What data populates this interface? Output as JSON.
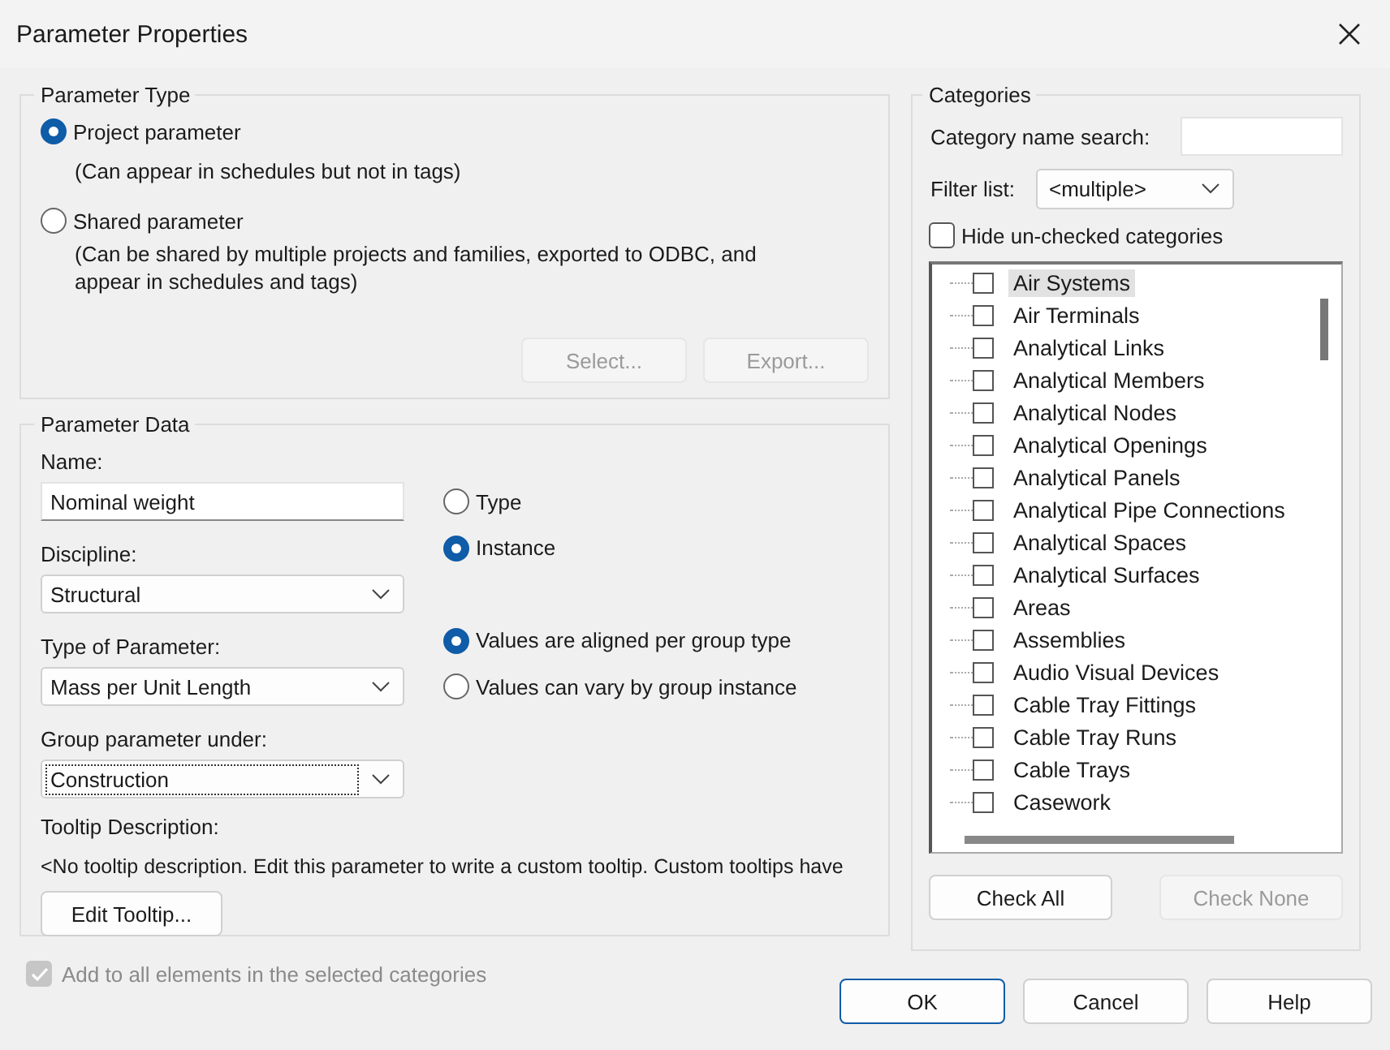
{
  "window": {
    "title": "Parameter Properties"
  },
  "parameter_type": {
    "title": "Parameter Type",
    "options": [
      {
        "label": "Project parameter",
        "description": "(Can appear in schedules but not in tags)",
        "selected": true
      },
      {
        "label": "Shared parameter",
        "description": "(Can be shared by multiple projects and families, exported to ODBC, and appear in schedules and tags)",
        "selected": false
      }
    ],
    "buttons": [
      {
        "label": "Select...",
        "disabled": true
      },
      {
        "label": "Export...",
        "disabled": true
      }
    ]
  },
  "parameter_data": {
    "title": "Parameter Data",
    "fields": [
      {
        "kind": "text",
        "label": "Name:",
        "value": "Nominal weight"
      },
      {
        "kind": "dropdown",
        "label": "Discipline:",
        "value": "Structural",
        "focused": false
      },
      {
        "kind": "dropdown",
        "label": "Type of Parameter:",
        "value": "Mass per Unit Length",
        "focused": false
      },
      {
        "kind": "dropdown",
        "label": "Group parameter under:",
        "value": "Construction",
        "focused": true
      }
    ],
    "type_options": [
      {
        "label": "Type",
        "selected": false
      },
      {
        "label": "Instance",
        "selected": true
      }
    ],
    "group_options": [
      {
        "label": "Values are aligned per group type",
        "selected": true
      },
      {
        "label": "Values can vary by group instance",
        "selected": false
      }
    ],
    "tooltip": {
      "label": "Tooltip Description:",
      "text": "<No tooltip description. Edit this parameter to write a custom tooltip. Custom tooltips have"
    },
    "edit_button": {
      "label": "Edit Tooltip...",
      "disabled": false
    }
  },
  "add_to_all": {
    "label": "Add to all elements in the selected categories",
    "checked": true,
    "disabled": true
  },
  "categories": {
    "title": "Categories",
    "search": {
      "label": "Category name search:"
    },
    "filter": {
      "label": "Filter list:",
      "value": "<multiple>"
    },
    "hide_unchecked": {
      "label": "Hide un-checked categories",
      "checked": false
    },
    "items": [
      {
        "label": "Air Systems",
        "checked": false,
        "selected": true
      },
      {
        "label": "Air Terminals",
        "checked": false,
        "selected": false
      },
      {
        "label": "Analytical Links",
        "checked": false,
        "selected": false
      },
      {
        "label": "Analytical Members",
        "checked": false,
        "selected": false
      },
      {
        "label": "Analytical Nodes",
        "checked": false,
        "selected": false
      },
      {
        "label": "Analytical Openings",
        "checked": false,
        "selected": false
      },
      {
        "label": "Analytical Panels",
        "checked": false,
        "selected": false
      },
      {
        "label": "Analytical Pipe Connections",
        "checked": false,
        "selected": false
      },
      {
        "label": "Analytical Spaces",
        "checked": false,
        "selected": false
      },
      {
        "label": "Analytical Surfaces",
        "checked": false,
        "selected": false
      },
      {
        "label": "Areas",
        "checked": false,
        "selected": false
      },
      {
        "label": "Assemblies",
        "checked": false,
        "selected": false
      },
      {
        "label": "Audio Visual Devices",
        "checked": false,
        "selected": false
      },
      {
        "label": "Cable Tray Fittings",
        "checked": false,
        "selected": false
      },
      {
        "label": "Cable Tray Runs",
        "checked": false,
        "selected": false
      },
      {
        "label": "Cable Trays",
        "checked": false,
        "selected": false
      },
      {
        "label": "Casework",
        "checked": false,
        "selected": false
      }
    ],
    "buttons": [
      {
        "label": "Check All",
        "disabled": false
      },
      {
        "label": "Check None",
        "disabled": true
      }
    ]
  },
  "buttons": [
    {
      "label": "OK",
      "default": true
    },
    {
      "label": "Cancel",
      "default": false
    },
    {
      "label": "Help",
      "default": false
    }
  ]
}
